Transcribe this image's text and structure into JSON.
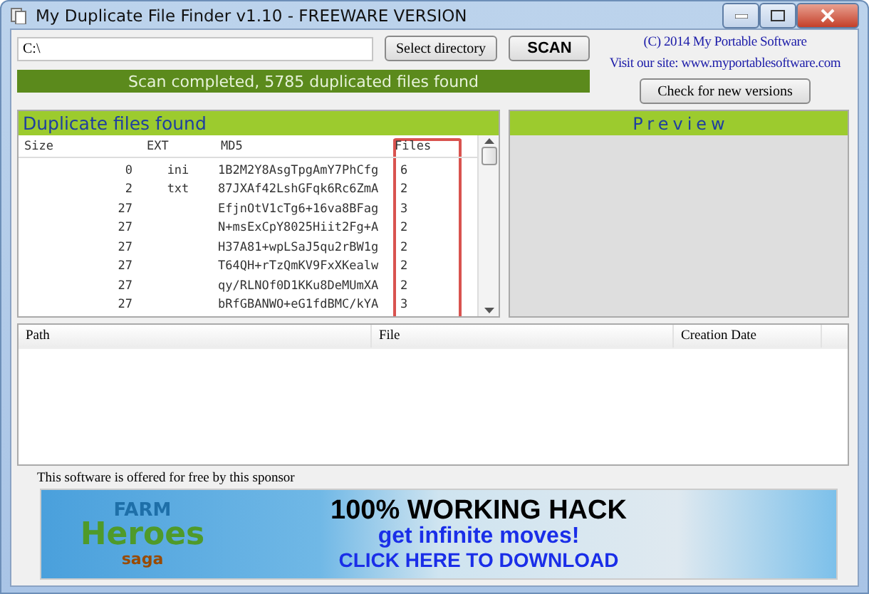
{
  "window": {
    "title": "My Duplicate File Finder v1.10 - FREEWARE VERSION"
  },
  "toolbar": {
    "path_value": "C:\\",
    "select_button": "Select directory",
    "scan_button": "SCAN",
    "copyright": "(C) 2014 My Portable Software",
    "site": "Visit our site: www.myportablesoftware.com",
    "status": "Scan completed, 5785 duplicated files found",
    "update_button": "Check for new versions"
  },
  "duplicates": {
    "title": "Duplicate files found",
    "columns": [
      "Size",
      "EXT",
      "MD5",
      "Files"
    ],
    "rows": [
      {
        "size": "0",
        "ext": "ini",
        "md5": "1B2M2Y8AsgTpgAmY7PhCfg",
        "files": "6"
      },
      {
        "size": "2",
        "ext": "txt",
        "md5": "87JXAf42LshGFqk6Rc6ZmA",
        "files": "2"
      },
      {
        "size": "27",
        "ext": "",
        "md5": "EfjnOtV1cTg6+16va8BFag",
        "files": "3"
      },
      {
        "size": "27",
        "ext": "",
        "md5": "N+msExCpY8025Hiit2Fg+A",
        "files": "2"
      },
      {
        "size": "27",
        "ext": "",
        "md5": "H37A81+wpLSaJ5qu2rBW1g",
        "files": "2"
      },
      {
        "size": "27",
        "ext": "",
        "md5": "T64QH+rTzQmKV9FxXKealw",
        "files": "2"
      },
      {
        "size": "27",
        "ext": "",
        "md5": "qy/RLNOf0D1KKu8DeMUmXA",
        "files": "2"
      },
      {
        "size": "27",
        "ext": "",
        "md5": "bRfGBANWO+eG1fdBMC/kYA",
        "files": "3"
      }
    ]
  },
  "preview": {
    "title": "Preview"
  },
  "files_table": {
    "columns": [
      "Path",
      "File",
      "Creation Date"
    ]
  },
  "sponsor": {
    "caption": "This software is offered for free by this sponsor",
    "banner": {
      "logo_top": "FARM",
      "logo_main": "Heroes",
      "logo_bottom": "saga",
      "headline": "100% WORKING HACK",
      "subline": "get infinite moves!",
      "cta": "CLICK HERE TO DOWNLOAD"
    }
  }
}
